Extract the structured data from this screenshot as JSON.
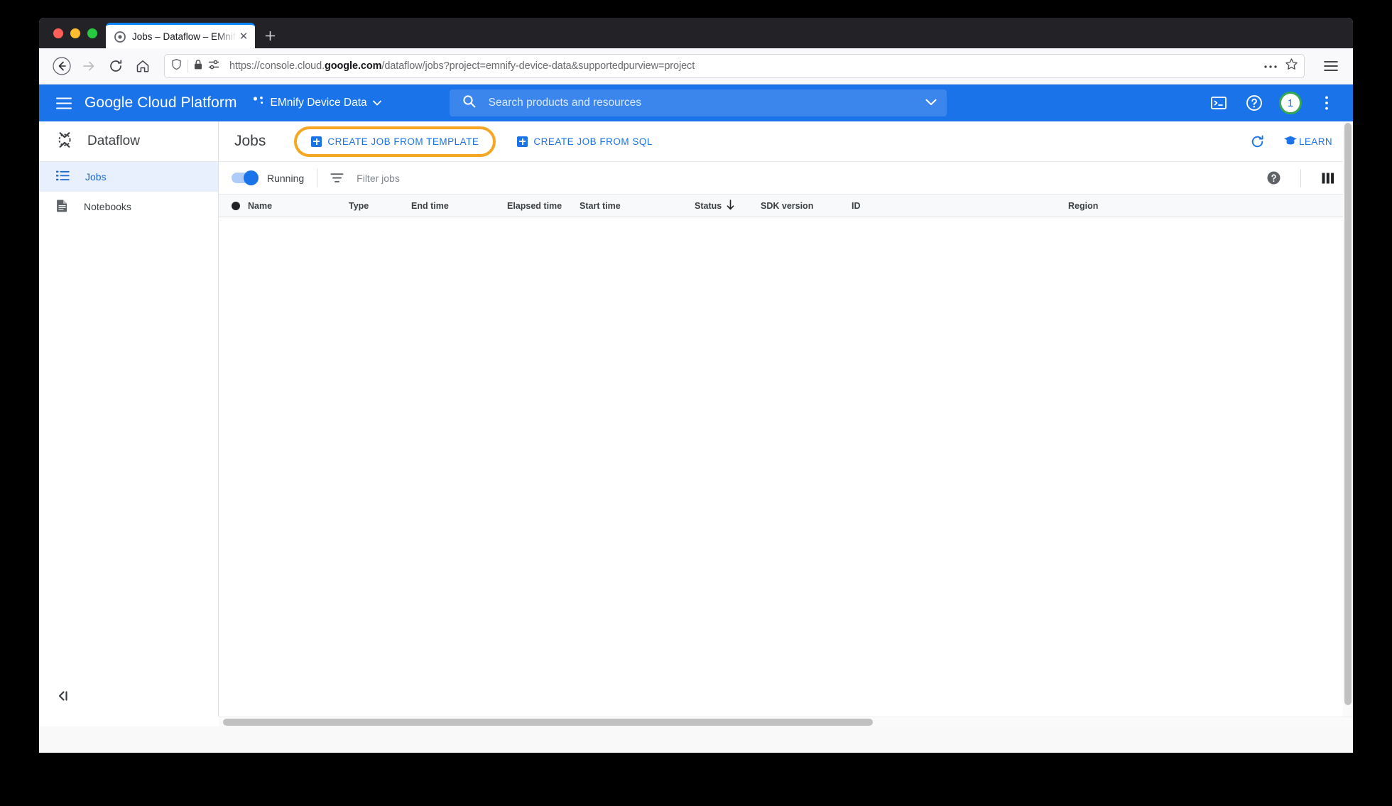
{
  "browser": {
    "tab": {
      "title": "Jobs – Dataflow – EMnify Device Data",
      "favicon_icon": "dataflow-favicon-icon",
      "close_icon": "close-icon"
    },
    "new_tab_icon": "plus-icon",
    "nav": {
      "back_icon": "back-arrow-icon",
      "forward_icon": "forward-arrow-icon",
      "reload_icon": "reload-icon",
      "home_icon": "home-icon"
    },
    "url_bar": {
      "shield_icon": "shield-icon",
      "lock_icon": "lock-icon",
      "permissions_icon": "permissions-icon",
      "url_prefix": "https://console.cloud.",
      "url_domain": "google.com",
      "url_suffix": "/dataflow/jobs?project=emnify-device-data&supportedpurview=project",
      "page_actions_icon": "ellipsis-icon",
      "bookmark_icon": "star-icon"
    },
    "menu_icon": "hamburger-menu-icon"
  },
  "gcp_header": {
    "menu_icon": "hamburger-menu-icon",
    "brand": "Google Cloud Platform",
    "project_icon": "project-scope-icon",
    "project_name": "EMnify Device Data",
    "project_dropdown_icon": "chevron-down-icon",
    "search": {
      "search_icon": "search-icon",
      "placeholder": "Search products and resources",
      "expand_icon": "chevron-down-icon"
    },
    "cloud_shell_icon": "cloud-shell-terminal-icon",
    "help_icon": "help-circle-icon",
    "avatar_count": "1",
    "more_icon": "more-vert-icon"
  },
  "sidebar": {
    "product_icon": "dataflow-product-icon",
    "product_title": "Dataflow",
    "items": [
      {
        "label": "Jobs",
        "icon": "list-icon",
        "active": true
      },
      {
        "label": "Notebooks",
        "icon": "notebook-document-icon",
        "active": false
      }
    ],
    "collapse_icon": "collapse-panel-icon"
  },
  "content_header": {
    "page_title": "Jobs",
    "create_from_template_label": "CREATE JOB FROM TEMPLATE",
    "create_from_template_icon": "plus-box-icon",
    "create_from_sql_label": "CREATE JOB FROM SQL",
    "create_from_sql_icon": "plus-box-icon",
    "refresh_icon": "refresh-icon",
    "learn_label": "LEARN",
    "learn_icon": "graduation-cap-icon",
    "highlight_color": "#f5a623"
  },
  "filter_toolbar": {
    "running_toggle_on": true,
    "running_label": "Running",
    "filter_icon": "filter-list-icon",
    "filter_placeholder": "Filter jobs",
    "help_icon": "help-filled-icon",
    "columns_icon": "column-settings-icon"
  },
  "jobs_table": {
    "columns": [
      {
        "label": "Name",
        "has_radio": true
      },
      {
        "label": "Type"
      },
      {
        "label": "End time"
      },
      {
        "label": "Elapsed time"
      },
      {
        "label": "Start time"
      },
      {
        "label": "Status",
        "sort_icon": "sort-descending-arrow-icon"
      },
      {
        "label": "SDK version"
      },
      {
        "label": "ID"
      },
      {
        "label": "Region"
      }
    ],
    "rows": []
  },
  "colors": {
    "gcp_blue": "#1a73e8",
    "accent_green": "#34a853",
    "highlight_orange": "#f5a623",
    "active_nav_bg": "#e8f0fe"
  }
}
